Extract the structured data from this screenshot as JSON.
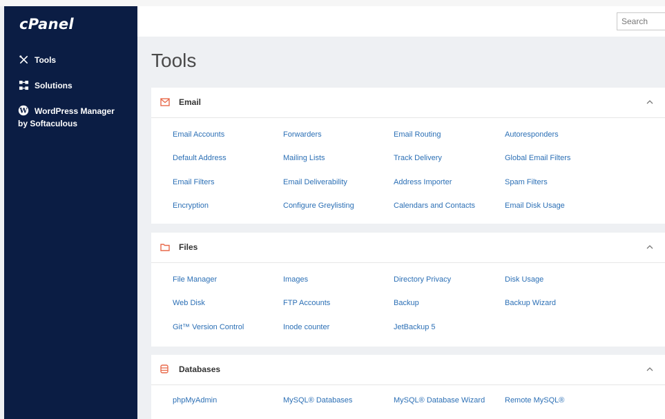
{
  "sidebar": {
    "logo": "cPanel",
    "items": [
      {
        "label": "Tools",
        "icon": "tools-icon"
      },
      {
        "label": "Solutions",
        "icon": "solutions-icon"
      },
      {
        "label": "WordPress Manager by Softaculous",
        "icon": "wordpress-icon"
      }
    ]
  },
  "header": {
    "search_placeholder": "Search"
  },
  "page_title": "Tools",
  "colors": {
    "sidebar_bg": "#0b1d44",
    "section_icon": "#e8694a",
    "link": "#2b6fb5"
  },
  "sections": [
    {
      "title": "Email",
      "icon": "envelope-icon",
      "links": [
        "Email Accounts",
        "Forwarders",
        "Email Routing",
        "Autoresponders",
        "Default Address",
        "Mailing Lists",
        "Track Delivery",
        "Global Email Filters",
        "Email Filters",
        "Email Deliverability",
        "Address Importer",
        "Spam Filters",
        "Encryption",
        "Configure Greylisting",
        "Calendars and Contacts",
        "Email Disk Usage"
      ]
    },
    {
      "title": "Files",
      "icon": "folder-icon",
      "links": [
        "File Manager",
        "Images",
        "Directory Privacy",
        "Disk Usage",
        "Web Disk",
        "FTP Accounts",
        "Backup",
        "Backup Wizard",
        "Git™ Version Control",
        "Inode counter",
        "JetBackup 5"
      ]
    },
    {
      "title": "Databases",
      "icon": "database-icon",
      "links": [
        "phpMyAdmin",
        "MySQL® Databases",
        "MySQL® Database Wizard",
        "Remote MySQL®"
      ]
    }
  ]
}
